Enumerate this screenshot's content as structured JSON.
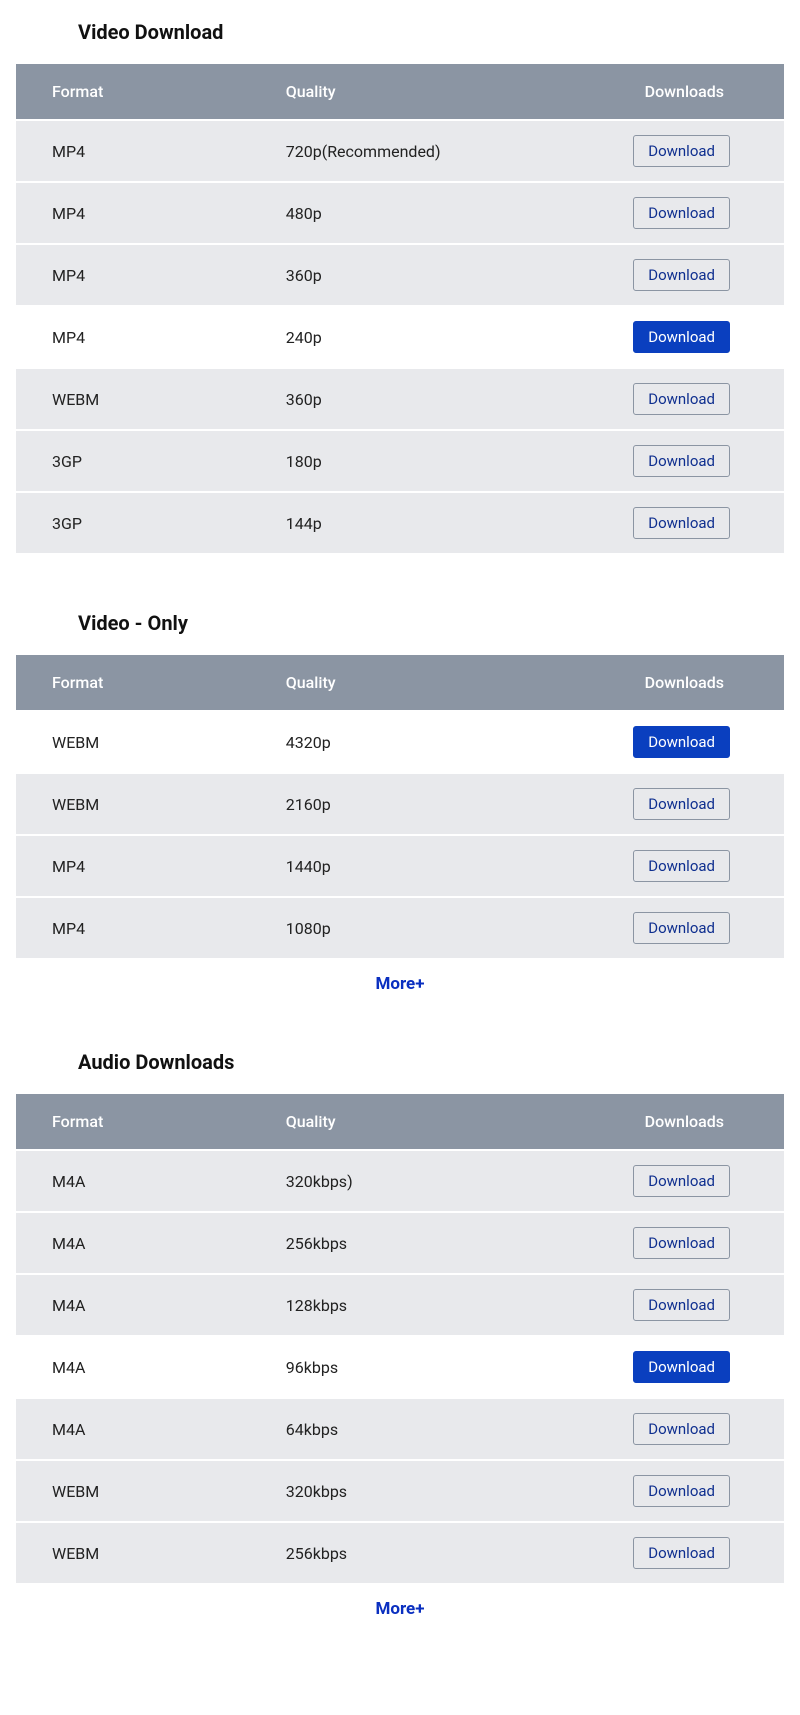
{
  "headers": {
    "format": "Format",
    "quality": "Quality",
    "downloads": "Downloads"
  },
  "button_label": "Download",
  "more_label": "More+",
  "sections": [
    {
      "title": "Video Download",
      "show_more": false,
      "rows": [
        {
          "format": "MP4",
          "quality": "720p(Recommended)",
          "active": false
        },
        {
          "format": "MP4",
          "quality": "480p",
          "active": false
        },
        {
          "format": "MP4",
          "quality": "360p",
          "active": false
        },
        {
          "format": "MP4",
          "quality": "240p",
          "active": true
        },
        {
          "format": "WEBM",
          "quality": "360p",
          "active": false
        },
        {
          "format": "3GP",
          "quality": "180p",
          "active": false
        },
        {
          "format": "3GP",
          "quality": "144p",
          "active": false
        }
      ]
    },
    {
      "title": "Video - Only",
      "show_more": true,
      "rows": [
        {
          "format": "WEBM",
          "quality": "4320p",
          "active": true
        },
        {
          "format": "WEBM",
          "quality": "2160p",
          "active": false
        },
        {
          "format": "MP4",
          "quality": "1440p",
          "active": false
        },
        {
          "format": "MP4",
          "quality": "1080p",
          "active": false
        }
      ]
    },
    {
      "title": "Audio Downloads",
      "show_more": true,
      "rows": [
        {
          "format": "M4A",
          "quality": "320kbps)",
          "active": false
        },
        {
          "format": "M4A",
          "quality": "256kbps",
          "active": false
        },
        {
          "format": "M4A",
          "quality": "128kbps",
          "active": false
        },
        {
          "format": "M4A",
          "quality": "96kbps",
          "active": true
        },
        {
          "format": "M4A",
          "quality": "64kbps",
          "active": false
        },
        {
          "format": "WEBM",
          "quality": "320kbps",
          "active": false
        },
        {
          "format": "WEBM",
          "quality": "256kbps",
          "active": false
        }
      ]
    }
  ]
}
